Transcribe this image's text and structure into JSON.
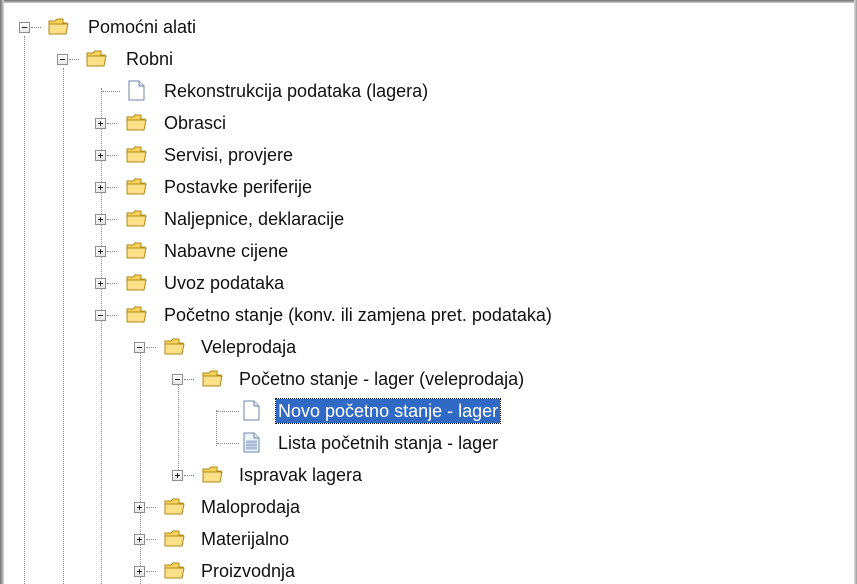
{
  "tree": {
    "nodes": [
      {
        "id": "pomocni-alati",
        "label": "Pomoćni alati",
        "type": "folder",
        "expanded": true
      },
      {
        "id": "robni",
        "label": "Robni",
        "type": "folder",
        "expanded": true
      },
      {
        "id": "rekonstrukcija",
        "label": "Rekonstrukcija podataka (lagera)",
        "type": "document"
      },
      {
        "id": "obrasci",
        "label": "Obrasci",
        "type": "folder",
        "expanded": false
      },
      {
        "id": "servisi",
        "label": "Servisi, provjere",
        "type": "folder",
        "expanded": false
      },
      {
        "id": "postavke",
        "label": "Postavke periferije",
        "type": "folder",
        "expanded": false
      },
      {
        "id": "naljepnice",
        "label": "Naljepnice, deklaracije",
        "type": "folder",
        "expanded": false
      },
      {
        "id": "nabavne",
        "label": "Nabavne cijene",
        "type": "folder",
        "expanded": false
      },
      {
        "id": "uvoz",
        "label": "Uvoz podataka",
        "type": "folder",
        "expanded": false
      },
      {
        "id": "pocetno-stanje",
        "label": "Početno stanje (konv. ili zamjena pret. podataka)",
        "type": "folder",
        "expanded": true
      },
      {
        "id": "veleprodaja",
        "label": "Veleprodaja",
        "type": "folder",
        "expanded": true
      },
      {
        "id": "pocetno-lager",
        "label": "Početno stanje - lager (veleprodaja)",
        "type": "folder",
        "expanded": true
      },
      {
        "id": "novo-pocetno",
        "label": "Novo početno stanje - lager",
        "type": "document",
        "selected": true
      },
      {
        "id": "lista-pocetnih",
        "label": "Lista početnih stanja - lager",
        "type": "document-lines"
      },
      {
        "id": "ispravak",
        "label": "Ispravak lagera",
        "type": "folder",
        "expanded": false
      },
      {
        "id": "maloprodaja",
        "label": "Maloprodaja",
        "type": "folder",
        "expanded": false
      },
      {
        "id": "materijalno",
        "label": "Materijalno",
        "type": "folder",
        "expanded": false
      },
      {
        "id": "proizvodnja",
        "label": "Proizvodnja",
        "type": "folder",
        "expanded": false
      }
    ]
  },
  "colors": {
    "selection": "#316ac5",
    "folder": "#f5c63a",
    "tree_line": "#8c8c8c"
  }
}
